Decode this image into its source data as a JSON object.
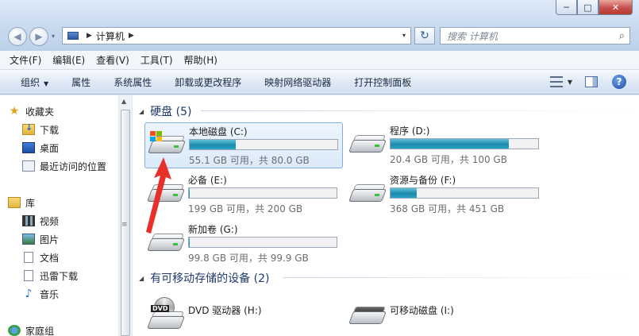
{
  "window": {
    "min_label": "─",
    "max_label": "□",
    "close_label": "✕"
  },
  "nav": {
    "back_label": "◀",
    "forward_label": "▶",
    "drop": "▾"
  },
  "address": {
    "sep1": "▶",
    "path": "计算机",
    "sep2": "▶",
    "drop": "▾"
  },
  "refresh_label": "↻",
  "search": {
    "placeholder": "搜索 计算机",
    "icon": "⌕"
  },
  "menu": [
    "文件(F)",
    "编辑(E)",
    "查看(V)",
    "工具(T)",
    "帮助(H)"
  ],
  "toolbar": {
    "organize": "组织",
    "caret": "▼",
    "items": [
      "属性",
      "系统属性",
      "卸载或更改程序",
      "映射网络驱动器",
      "打开控制面板"
    ],
    "view_caret": "▼",
    "help": "?"
  },
  "sidebar": {
    "favorites": "收藏夹",
    "downloads": "下载",
    "desktop": "桌面",
    "recent": "最近访问的位置",
    "library": "库",
    "video": "视频",
    "pictures": "图片",
    "documents": "文档",
    "xunlei": "迅雷下载",
    "music": "音乐",
    "homegroup": "家庭组"
  },
  "scroll": {
    "up": "▲",
    "grip": "≡"
  },
  "sections": {
    "hdd": "硬盘 (5)",
    "removable": "有可移动存储的设备 (2)",
    "tri": "◢"
  },
  "drives": [
    {
      "name": "本地磁盘 (C:)",
      "space": "55.1 GB 可用，共 80.0 GB",
      "used_fraction": 0.31
    },
    {
      "name": "程序 (D:)",
      "space": "20.4 GB 可用，共 100 GB",
      "used_fraction": 0.8
    },
    {
      "name": "必备 (E:)",
      "space": "199 GB 可用，共 200 GB",
      "used_fraction": 0.005
    },
    {
      "name": "资源与备份 (F:)",
      "space": "368 GB 可用，共 451 GB",
      "used_fraction": 0.18
    },
    {
      "name": "新加卷 (G:)",
      "space": "99.8 GB 可用，共 99.9 GB",
      "used_fraction": 0.001
    }
  ],
  "removable": [
    {
      "name": "DVD 驱动器 (H:)",
      "badge": "DVD"
    },
    {
      "name": "可移动磁盘 (I:)"
    }
  ],
  "colors": {
    "bar_fill": "#1c8aac",
    "arrow": "#e8302a"
  }
}
